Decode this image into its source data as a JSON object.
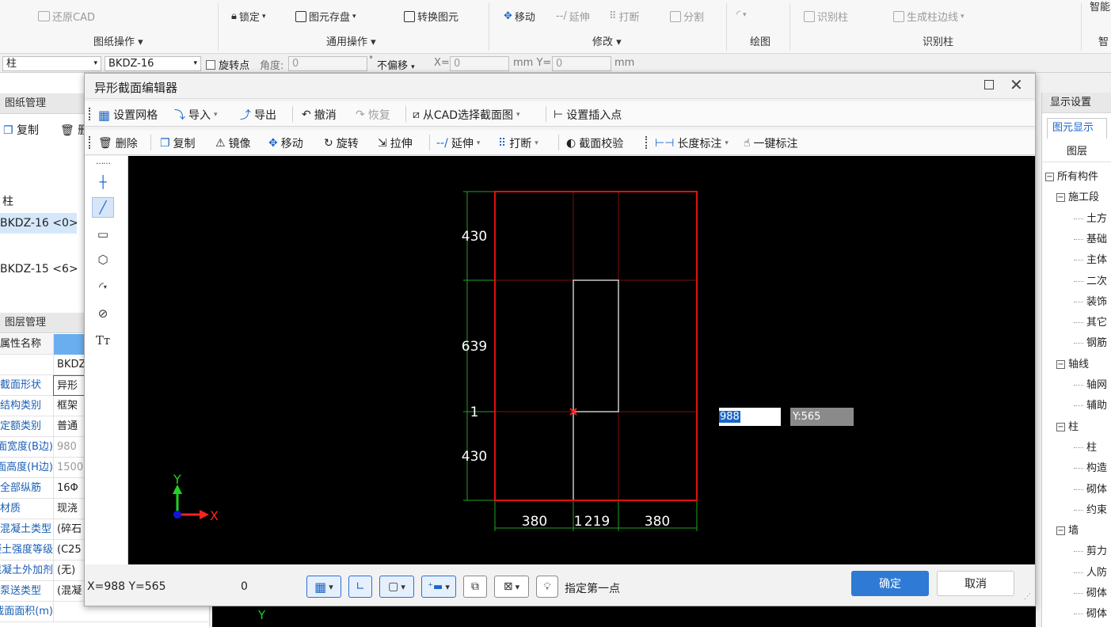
{
  "ribbon": {
    "items": {
      "restore_cad": "还原CAD",
      "lock": "锁定",
      "save_element": "图元存盘",
      "convert_element": "转换图元",
      "move": "移动",
      "extend": "延伸",
      "break": "打断",
      "split": "分割",
      "identify_column": "识别柱",
      "generate_column_edge": "生成柱边线",
      "smart": "智能"
    },
    "groups": {
      "drawing_ops": "图纸操作",
      "common_ops": "通用操作",
      "modify": "修改",
      "draw": "绘图",
      "identify_column": "识别柱",
      "smart": "智"
    }
  },
  "propbar": {
    "type": "柱",
    "name": "BKDZ-16",
    "rotate_point": "旋转点",
    "angle_label": "角度:",
    "angle_value": "0",
    "offset": "不偏移",
    "x_label": "X=",
    "x_value": "0",
    "y_label": "mm Y=",
    "y_value": "0",
    "unit": "mm"
  },
  "left_panel": {
    "drawing_title": "图纸管理",
    "copy": "复制",
    "delete_short": "删",
    "tree_root": "柱",
    "items": [
      "BKDZ-16 <0>",
      "BKDZ-15 <6>"
    ],
    "layer_title": "图层管理",
    "attr_header": "属性名称",
    "props": [
      {
        "k": "",
        "v": "BKDZ"
      },
      {
        "k": "截面形状",
        "v": "异形"
      },
      {
        "k": "结构类别",
        "v": "框架"
      },
      {
        "k": "定额类别",
        "v": "普通"
      },
      {
        "k": "截面宽度(B边)(...",
        "v": "980"
      },
      {
        "k": "截面高度(H边)(...",
        "v": "1500"
      },
      {
        "k": "全部纵筋",
        "v": "16Φ"
      },
      {
        "k": "材质",
        "v": "现浇"
      },
      {
        "k": "混凝土类型",
        "v": "(碎石"
      },
      {
        "k": "混凝土强度等级",
        "v": "(C25"
      },
      {
        "k": "混凝土外加剂",
        "v": "(无)"
      },
      {
        "k": "泵送类型",
        "v": "(混凝"
      },
      {
        "k": "截面面积(m)",
        "v": ""
      }
    ]
  },
  "right_panel": {
    "title": "显示设置",
    "tab": "图元显示",
    "header": "图层",
    "tree": [
      {
        "label": "所有构件",
        "lvl": 0,
        "box": "−"
      },
      {
        "label": "施工段",
        "lvl": 1,
        "box": "−"
      },
      {
        "label": "土方",
        "lvl": 2
      },
      {
        "label": "基础",
        "lvl": 2
      },
      {
        "label": "主体",
        "lvl": 2
      },
      {
        "label": "二次",
        "lvl": 2
      },
      {
        "label": "装饰",
        "lvl": 2
      },
      {
        "label": "其它",
        "lvl": 2
      },
      {
        "label": "钢筋",
        "lvl": 2
      },
      {
        "label": "轴线",
        "lvl": 1,
        "box": "−"
      },
      {
        "label": "轴网",
        "lvl": 2
      },
      {
        "label": "辅助",
        "lvl": 2
      },
      {
        "label": "柱",
        "lvl": 1,
        "box": "−"
      },
      {
        "label": "柱",
        "lvl": 2
      },
      {
        "label": "构造",
        "lvl": 2
      },
      {
        "label": "砌体",
        "lvl": 2
      },
      {
        "label": "约束",
        "lvl": 2
      },
      {
        "label": "墙",
        "lvl": 1,
        "box": "−"
      },
      {
        "label": "剪力",
        "lvl": 2
      },
      {
        "label": "人防",
        "lvl": 2
      },
      {
        "label": "砌体",
        "lvl": 2
      },
      {
        "label": "砌体",
        "lvl": 2
      }
    ]
  },
  "dialog": {
    "title": "异形截面编辑器",
    "toolbar1": {
      "set_grid": "设置网格",
      "import": "导入",
      "export": "导出",
      "undo": "撤消",
      "redo": "恢复",
      "from_cad": "从CAD选择截面图",
      "set_insert_point": "设置插入点"
    },
    "toolbar2": {
      "delete": "删除",
      "copy": "复制",
      "mirror": "镜像",
      "move": "移动",
      "rotate": "旋转",
      "stretch": "拉伸",
      "extend": "延伸",
      "break": "打断",
      "check": "截面校验",
      "length_dim": "长度标注",
      "one_key_dim": "一键标注"
    },
    "canvas": {
      "dims_left": [
        "430",
        "639",
        "1",
        "430"
      ],
      "dims_bottom": [
        "380",
        "1",
        "219",
        "380"
      ],
      "input_x": "988",
      "input_y": "Y:565",
      "axis_x": "X",
      "axis_y": "Y"
    },
    "status": {
      "coords": "X=988 Y=565",
      "angle": "0",
      "hint": "指定第一点",
      "ok": "确定",
      "cancel": "取消"
    }
  },
  "background_canvas": {
    "axis_y": "Y"
  },
  "colors": {
    "accent": "#2e7ad4",
    "frame_red": "#e01010",
    "grid_green": "#1fa51f",
    "grid_dark_red": "#7a1010"
  }
}
